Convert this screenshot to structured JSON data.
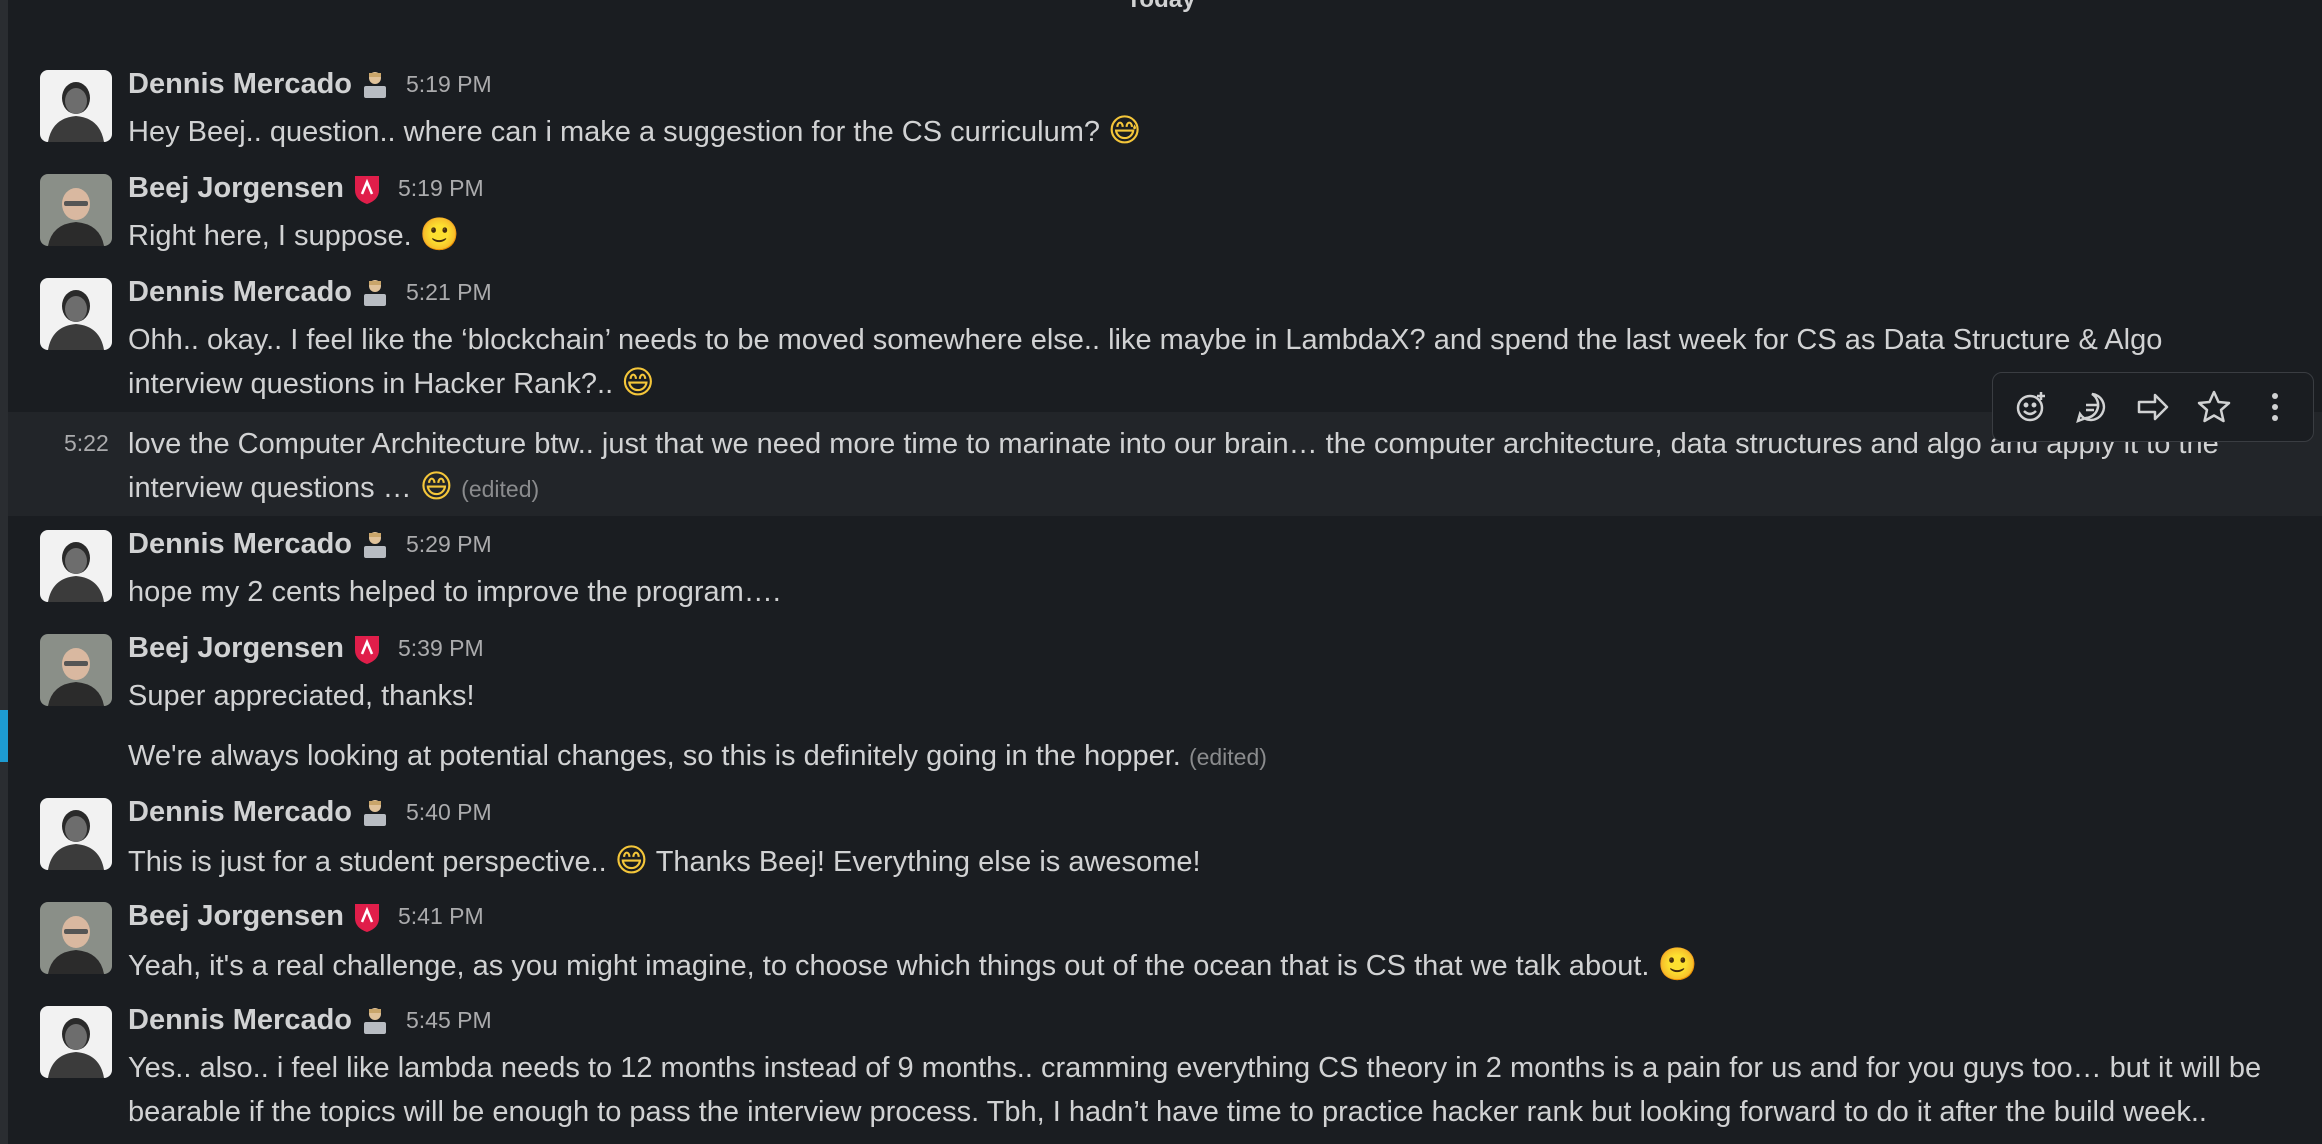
{
  "day_divider": "Today",
  "users": {
    "dennis": "Dennis Mercado",
    "beej": "Beej Jorgensen"
  },
  "colors": {
    "background": "#1a1d21",
    "hover_row": "#222529",
    "accent_bar": "#1d9bd1",
    "beej_badge": "#e01e4a"
  },
  "messages": [
    {
      "name": "Dennis Mercado",
      "time": "5:19 PM",
      "text": "Hey Beej.. question.. where can i make a suggestion for the CS curriculum?",
      "emoji": "😅"
    },
    {
      "name": "Beej Jorgensen",
      "time": "5:19 PM",
      "text": "Right here, I suppose.",
      "emoji": "🙂"
    },
    {
      "name": "Dennis Mercado",
      "time": "5:21 PM",
      "line1": "Ohh.. okay.. I feel like the ‘blockchain’ needs to be moved somewhere else.. like maybe in LambdaX? and spend the last week for CS as Data Structure & Algo",
      "line2": "interview questions in Hacker Rank?..",
      "emoji": "😄"
    },
    {
      "time": "5:22",
      "line1": "love the Computer Architecture btw.. just that we need more time to marinate into our brain… the computer architecture, data structures and algo and apply it to the",
      "line2": "interview questions …",
      "emoji": "😄",
      "edited": "(edited)"
    },
    {
      "name": "Dennis Mercado",
      "time": "5:29 PM",
      "text": "hope my 2 cents helped to improve the program…."
    },
    {
      "name": "Beej Jorgensen",
      "time": "5:39 PM",
      "text": "Super appreciated, thanks!",
      "followup": "We're always looking at potential changes, so this is definitely going in the hopper.",
      "edited": "(edited)"
    },
    {
      "name": "Dennis Mercado",
      "time": "5:40 PM",
      "text_before": "This is just for a student perspective..",
      "emoji": "😄",
      "text_after": "Thanks Beej! Everything else is awesome!"
    },
    {
      "name": "Beej Jorgensen",
      "time": "5:41 PM",
      "text": "Yeah, it's a real challenge, as you might imagine, to choose which things out of the ocean that is CS that we talk about.",
      "emoji": "🙂"
    },
    {
      "name": "Dennis Mercado",
      "time": "5:45 PM",
      "line1": "Yes.. also.. i feel like lambda needs to 12 months instead of 9 months.. cramming everything CS theory in 2 months is a pain for us and for you guys too…  but it will be",
      "line2": "bearable if the topics will be enough to pass the interview process. Tbh, I hadn’t have time to practice hacker rank but looking forward to do it after the build week.."
    }
  ],
  "toolbar_icons": [
    "add-reaction-icon",
    "reply-in-thread-icon",
    "share-message-icon",
    "save-star-icon",
    "more-actions-icon"
  ]
}
